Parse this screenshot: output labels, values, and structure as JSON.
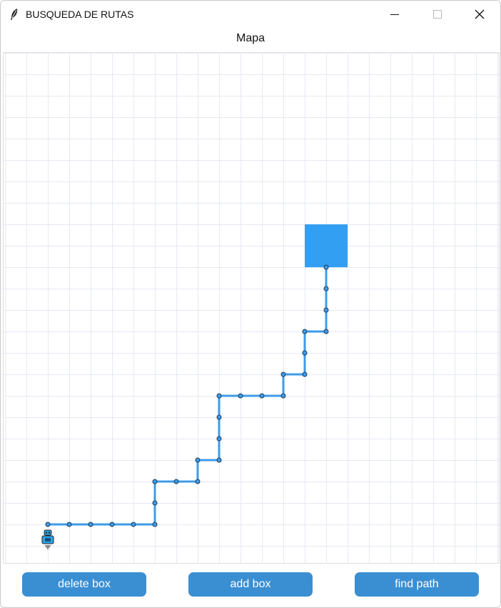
{
  "window": {
    "title": "BUSQUEDA DE RUTAS",
    "controls": [
      "minimize",
      "maximize",
      "close"
    ]
  },
  "map": {
    "label": "Mapa",
    "grid_cols": 23,
    "grid_rows": 23,
    "grid_color": "#e6e9f4",
    "obstacle_color": "#339ff2",
    "path_color": "#3d9be9",
    "obstacles": [
      {
        "col": 14,
        "row": 8,
        "w": 2,
        "h": 2
      }
    ],
    "path": [
      [
        2,
        22
      ],
      [
        3,
        22
      ],
      [
        4,
        22
      ],
      [
        5,
        22
      ],
      [
        6,
        22
      ],
      [
        7,
        22
      ],
      [
        7,
        21
      ],
      [
        7,
        20
      ],
      [
        8,
        20
      ],
      [
        9,
        20
      ],
      [
        9,
        19
      ],
      [
        10,
        19
      ],
      [
        10,
        18
      ],
      [
        10,
        17
      ],
      [
        10,
        16
      ],
      [
        11,
        16
      ],
      [
        12,
        16
      ],
      [
        13,
        16
      ],
      [
        13,
        15
      ],
      [
        14,
        15
      ],
      [
        14,
        14
      ],
      [
        14,
        13
      ],
      [
        15,
        13
      ],
      [
        15,
        12
      ],
      [
        15,
        11
      ],
      [
        15,
        10
      ]
    ],
    "robot": {
      "col": 2,
      "row": 22,
      "icon": "robot-icon"
    }
  },
  "buttons": {
    "delete": "delete box",
    "add": "add box",
    "find": "find path"
  },
  "colors": {
    "button_bg": "#3a8fd3",
    "button_text": "#ffffff"
  }
}
